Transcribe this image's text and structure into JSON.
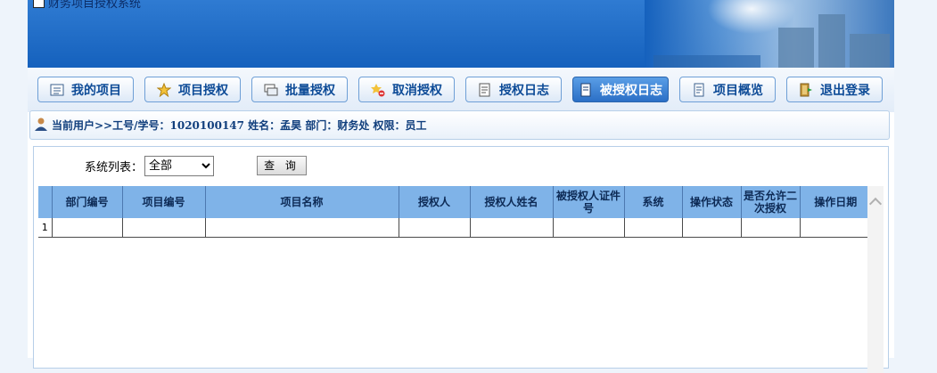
{
  "header": {
    "title": "财务项目授权系统"
  },
  "nav": {
    "items": [
      {
        "label": "我的项目",
        "icon": "list-icon"
      },
      {
        "label": "项目授权",
        "icon": "star-icon"
      },
      {
        "label": "批量授权",
        "icon": "stack-icon"
      },
      {
        "label": "取消授权",
        "icon": "cancel-icon"
      },
      {
        "label": "授权日志",
        "icon": "log-icon"
      },
      {
        "label": "被授权日志",
        "icon": "document-icon",
        "active": true
      },
      {
        "label": "项目概览",
        "icon": "overview-icon"
      },
      {
        "label": "退出登录",
        "icon": "exit-icon"
      }
    ]
  },
  "user": {
    "text": "当前用户>>工号/学号：1020100147 姓名：孟昊 部门：财务处 权限：员工"
  },
  "filter": {
    "label": "系统列表：",
    "selected": "全部",
    "query_label": "查 询"
  },
  "table": {
    "columns": [
      "",
      "部门编号",
      "项目编号",
      "项目名称",
      "授权人",
      "授权人姓名",
      "被授权人证件号",
      "系统",
      "操作状态",
      "是否允许二次授权",
      "操作日期"
    ],
    "rows": [
      {
        "num": "1",
        "cells": [
          "",
          "",
          "",
          "",
          "",
          "",
          "",
          "",
          "",
          ""
        ]
      }
    ]
  },
  "colors": {
    "header_bg": "#1561bd",
    "active_nav": "#2b6fc6",
    "table_header": "#7fb3e8"
  }
}
